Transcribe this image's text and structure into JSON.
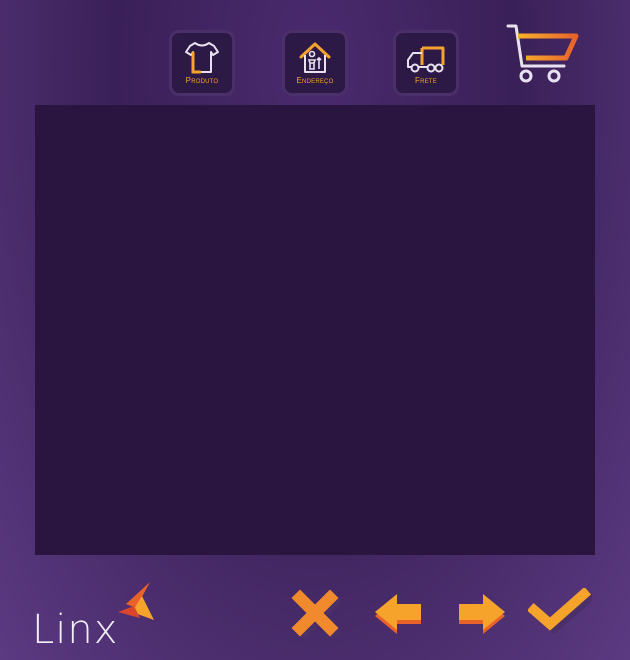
{
  "steps": [
    {
      "label": "Produto",
      "icon": "shirt-icon"
    },
    {
      "label": "Endereço",
      "icon": "house-icon"
    },
    {
      "label": "Frete",
      "icon": "truck-icon"
    }
  ],
  "cart": {
    "icon": "cart-icon"
  },
  "logo": {
    "text": "Linx"
  },
  "actions": {
    "cancel": {
      "icon": "close-icon"
    },
    "back": {
      "icon": "arrow-left-icon"
    },
    "forward": {
      "icon": "arrow-right-icon"
    },
    "confirm": {
      "icon": "check-icon"
    }
  },
  "colors": {
    "accent": "#f5a32a",
    "accent_dark": "#e0752a",
    "panel": "#2a1440",
    "background": "#3a2058"
  }
}
